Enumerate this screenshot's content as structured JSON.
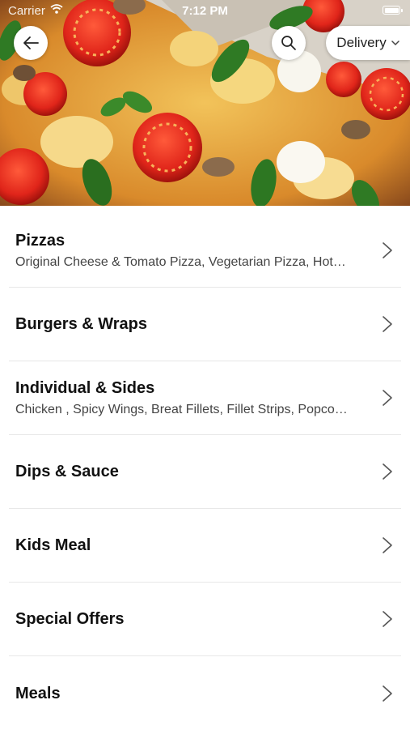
{
  "status_bar": {
    "carrier": "Carrier",
    "time": "7:12 PM"
  },
  "header": {
    "back_icon": "arrow-left-icon",
    "search_icon": "search-icon",
    "delivery_label": "Delivery",
    "delivery_icon": "chevron-down-icon"
  },
  "menu": {
    "items": [
      {
        "title": "Pizzas",
        "subtitle": "Original Cheese & Tomato Pizza, Vegetarian Pizza, Hot…"
      },
      {
        "title": "Burgers & Wraps",
        "subtitle": ""
      },
      {
        "title": "Individual & Sides",
        "subtitle": "Chicken , Spicy Wings, Breat Fillets, Fillet Strips, Popco…"
      },
      {
        "title": "Dips & Sauce",
        "subtitle": ""
      },
      {
        "title": "Kids Meal",
        "subtitle": ""
      },
      {
        "title": "Special Offers",
        "subtitle": ""
      },
      {
        "title": "Meals",
        "subtitle": ""
      }
    ]
  },
  "colors": {
    "background": "#ffffff",
    "divider": "#e7e7e7",
    "chevron": "#555555"
  }
}
